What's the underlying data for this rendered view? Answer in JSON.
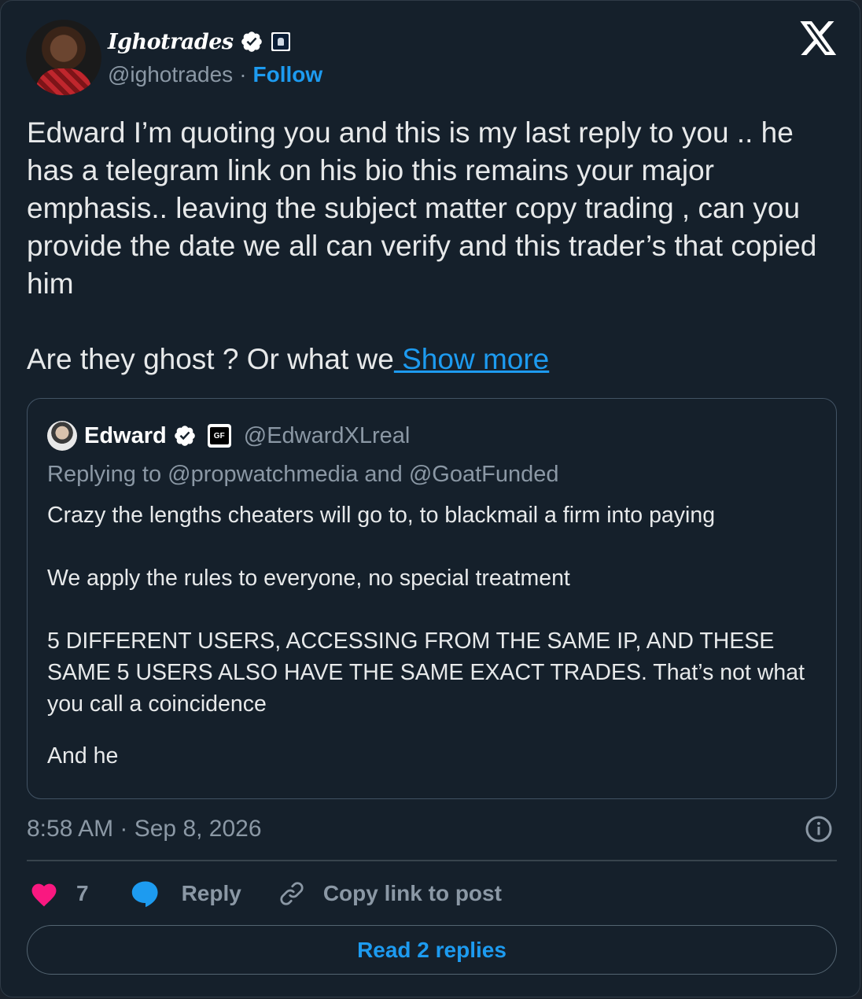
{
  "author": {
    "display_name": "Ighotrades",
    "handle": "@ighotrades",
    "separator": "·",
    "follow_label": "Follow"
  },
  "tweet": {
    "text_para1": "Edward I’m quoting you and this is my last reply to you .. he has a telegram link on his bio this remains your major emphasis.. leaving the subject matter copy trading , can you provide the date we all can verify and this trader’s that copied him",
    "text_para2": "Are they ghost ? Or what we",
    "show_more": " Show more",
    "timestamp": "8:58 AM · Sep 8, 2026"
  },
  "quote": {
    "display_name": "Edward",
    "badge_text": "GF",
    "handle": "@EdwardXLreal",
    "replying_to": "Replying to @propwatchmedia and @GoatFunded",
    "para1": "Crazy the lengths cheaters will go to, to blackmail a firm into paying",
    "para2": "We apply the rules to everyone, no special treatment",
    "para3": "5 DIFFERENT USERS, ACCESSING FROM THE SAME IP, AND THESE SAME 5 USERS ALSO HAVE THE SAME EXACT TRADES. That’s not what you call a coincidence",
    "para4": "And he"
  },
  "actions": {
    "like_count": "7",
    "reply_label": "Reply",
    "copy_link_label": "Copy link to post",
    "read_replies_label": "Read 2 replies"
  },
  "icons": {
    "x_logo": "x-logo-icon",
    "verified": "verified-badge-icon",
    "heart": "heart-icon",
    "reply": "reply-bubble-icon",
    "link": "link-icon",
    "info": "info-icon"
  },
  "colors": {
    "background": "#15202b",
    "accent": "#1d9bf0",
    "like": "#f91880",
    "muted": "#8b98a5"
  }
}
